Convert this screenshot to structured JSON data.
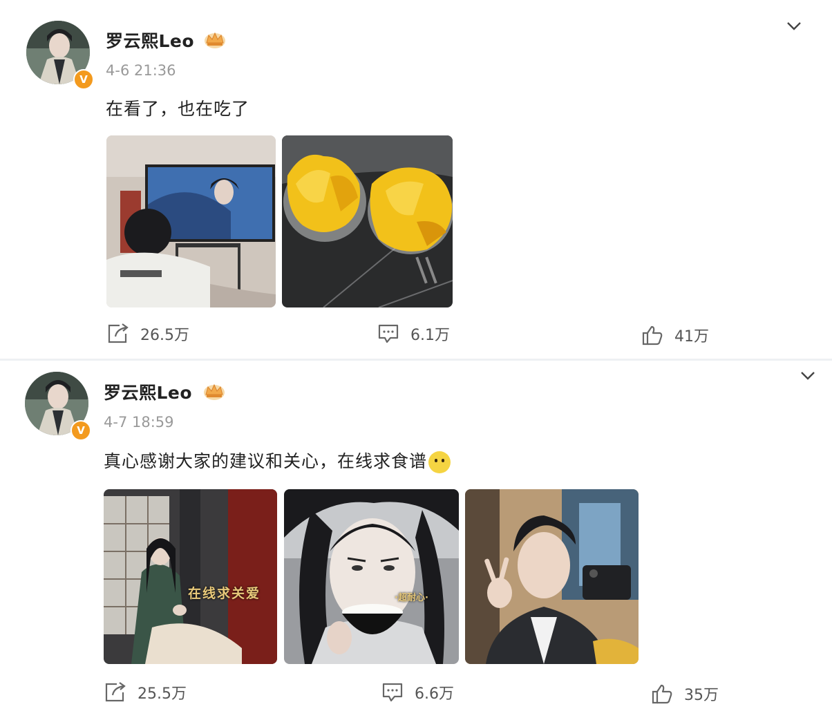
{
  "posts": [
    {
      "author": "罗云熙Leo",
      "time": "4-6 21:36",
      "text": "在看了，也在吃了",
      "images": [
        "tv-watching-photo",
        "jackfruit-bowls-photo"
      ],
      "repost_count": "26.5万",
      "comment_count": "6.1万",
      "like_count": "41万"
    },
    {
      "author": "罗云熙Leo",
      "time": "4-7 18:59",
      "text": "真心感谢大家的建议和关心，在线求食谱",
      "emoji": "chick-emoji",
      "images": [
        "drama-scene-photo",
        "eating-rice-photo",
        "selfie-photo"
      ],
      "overlay_text": [
        "在线求关爱",
        "·超耐心·"
      ],
      "repost_count": "25.5万",
      "comment_count": "6.6万",
      "like_count": "35万"
    }
  ],
  "icons": {
    "verified": "V",
    "verified_color": "#f39a1e",
    "crown_color": "#f2a94a"
  }
}
